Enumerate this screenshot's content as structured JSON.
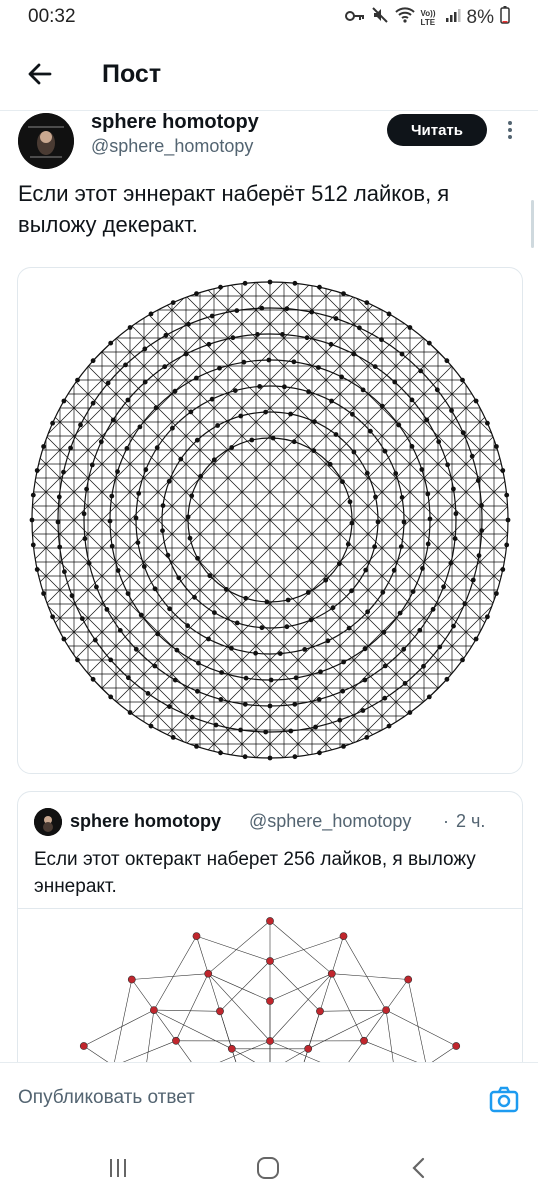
{
  "status_bar": {
    "time": "00:32",
    "lte_label": "Vo)) LTE",
    "battery": "8%"
  },
  "header": {
    "title": "Пост",
    "back_icon": "arrow-left-icon"
  },
  "post": {
    "author_name": "sphere homotopy",
    "author_handle": "@sphere_homotopy",
    "follow_label": "Читать",
    "text": "Если этот эннеракт наберёт 512 лайков, я выложу декеракт.",
    "media": "9-cube-projection"
  },
  "quoted_post": {
    "author_name": "sphere homotopy",
    "author_handle": "@sphere_homotopy",
    "separator": "·",
    "time": "2 ч.",
    "text": "Если этот октеракт наберет 256 лайков, я выложу эннеракт.",
    "media": "8-cube-projection"
  },
  "reply_bar": {
    "placeholder": "Опубликовать ответ",
    "camera_icon": "camera-icon"
  },
  "navbar": {
    "icons": [
      "recent-apps-icon",
      "home-icon",
      "back-icon"
    ]
  },
  "colors": {
    "accent": "#1d9bf0",
    "text": "#0f1419",
    "muted": "#536471",
    "vertex_red": "#c0262d"
  }
}
